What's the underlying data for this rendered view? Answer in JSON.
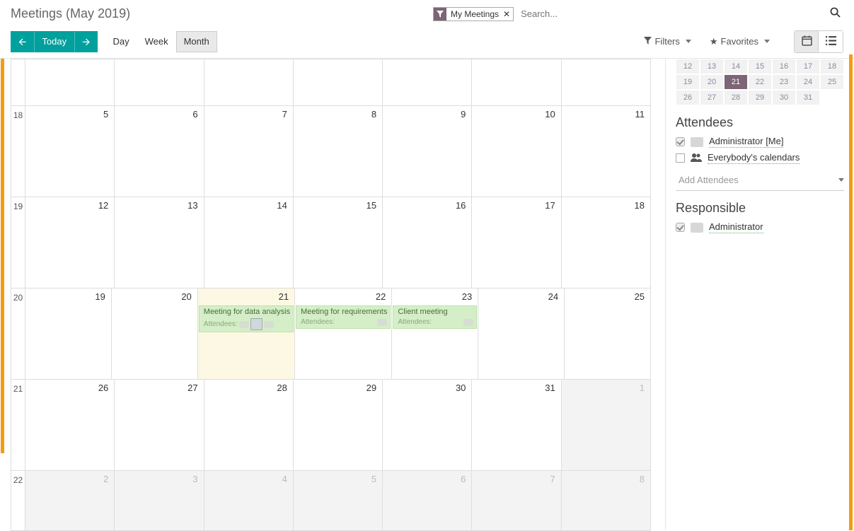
{
  "header": {
    "title": "Meetings (May 2019)",
    "facet_label": "My Meetings",
    "search_placeholder": "Search..."
  },
  "toolbar": {
    "today": "Today",
    "views": {
      "day": "Day",
      "week": "Week",
      "month": "Month"
    },
    "filters": "Filters",
    "favorites": "Favorites"
  },
  "calendar": {
    "weekNumbers": [
      "18",
      "19",
      "20",
      "21",
      "22"
    ],
    "rows": [
      [
        {
          "n": "5"
        },
        {
          "n": "6"
        },
        {
          "n": "7"
        },
        {
          "n": "8"
        },
        {
          "n": "9"
        },
        {
          "n": "10"
        },
        {
          "n": "11"
        }
      ],
      [
        {
          "n": "12"
        },
        {
          "n": "13"
        },
        {
          "n": "14"
        },
        {
          "n": "15"
        },
        {
          "n": "16"
        },
        {
          "n": "17"
        },
        {
          "n": "18"
        }
      ],
      [
        {
          "n": "19"
        },
        {
          "n": "20"
        },
        {
          "n": "21",
          "today": true,
          "events": [
            {
              "t": "Meeting for data analysis",
              "avatars": 2
            }
          ]
        },
        {
          "n": "22",
          "events": [
            {
              "t": "Meeting for requirements"
            }
          ]
        },
        {
          "n": "23",
          "events": [
            {
              "t": "Client meeting"
            }
          ]
        },
        {
          "n": "24"
        },
        {
          "n": "25"
        }
      ],
      [
        {
          "n": "26"
        },
        {
          "n": "27"
        },
        {
          "n": "28"
        },
        {
          "n": "29"
        },
        {
          "n": "30"
        },
        {
          "n": "31"
        },
        {
          "n": "1",
          "next": true
        }
      ],
      [
        {
          "n": "2",
          "next": true
        },
        {
          "n": "3",
          "next": true
        },
        {
          "n": "4",
          "next": true
        },
        {
          "n": "5",
          "next": true
        },
        {
          "n": "6",
          "next": true
        },
        {
          "n": "7",
          "next": true
        },
        {
          "n": "8",
          "next": true
        }
      ]
    ],
    "attendees_label": "Attendees:"
  },
  "mini": {
    "rows": [
      [
        "12",
        "13",
        "14",
        "15",
        "16",
        "17",
        "18"
      ],
      [
        "19",
        "20",
        "21",
        "22",
        "23",
        "24",
        "25"
      ],
      [
        "26",
        "27",
        "28",
        "29",
        "30",
        "31",
        ""
      ]
    ],
    "selected": "21"
  },
  "sidebar": {
    "attendees_title": "Attendees",
    "responsible_title": "Responsible",
    "admin_me": "Administrator [Me]",
    "everybody": "Everybody's calendars",
    "add_placeholder": "Add Attendees",
    "admin": "Administrator"
  }
}
